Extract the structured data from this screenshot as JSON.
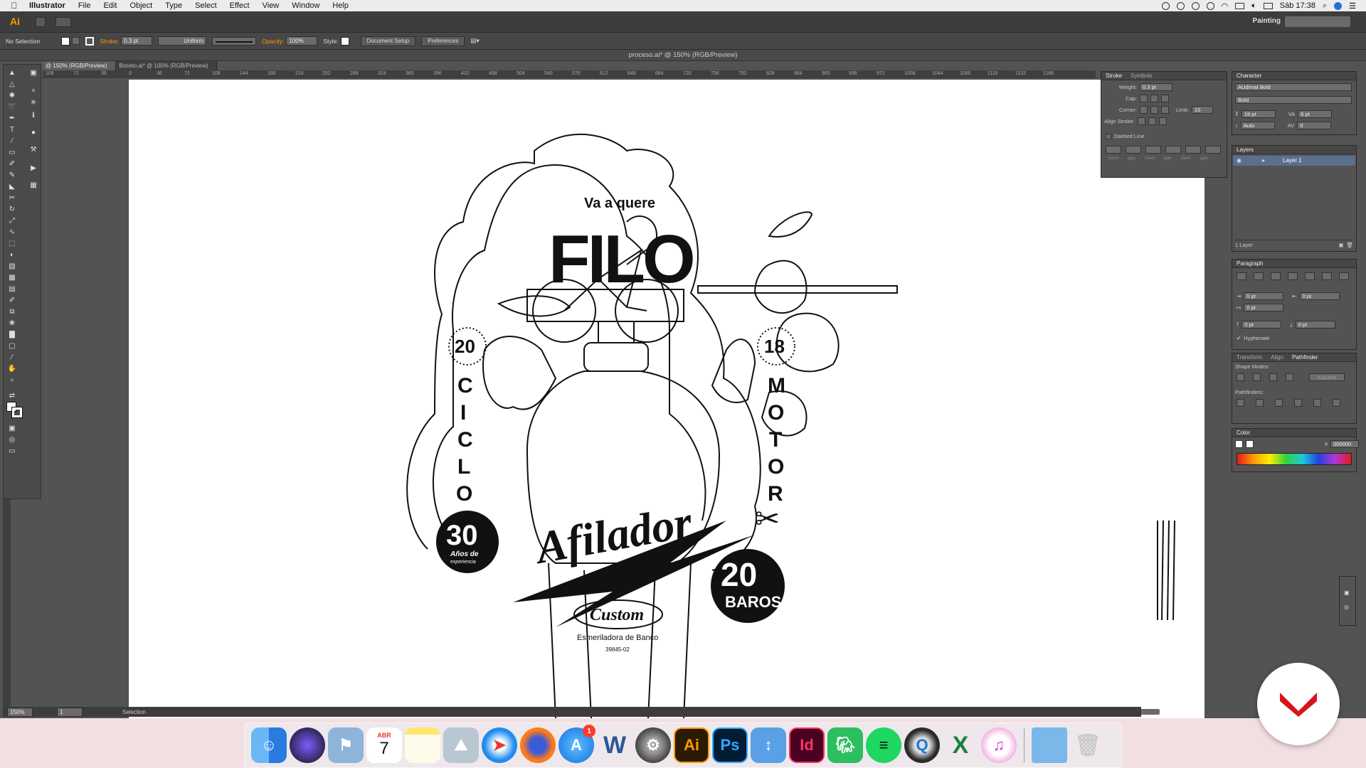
{
  "menubar": {
    "app": "Illustrator",
    "items": [
      "File",
      "Edit",
      "Object",
      "Type",
      "Select",
      "Effect",
      "View",
      "Window",
      "Help"
    ],
    "clock": "Sáb 17:38"
  },
  "appbar": {
    "workspace": "Painting"
  },
  "controlbar": {
    "selection": "No Selection",
    "stroke_label": "Stroke:",
    "stroke_value": "0.3 pt",
    "profile": "Uniform",
    "opacity_label": "Opacity:",
    "opacity_value": "100%",
    "style_label": "Style:",
    "doc_setup": "Document Setup",
    "preferences": "Preferences"
  },
  "title": "proceso.ai* @ 150% (RGB/Preview)",
  "tabs": [
    "@ 150% (RGB/Preview)",
    "Boceto.ai* @ 100% (RGB/Preview)"
  ],
  "ruler_ticks": [
    "108",
    "72",
    "36",
    "0",
    "36",
    "72",
    "108",
    "144",
    "180",
    "216",
    "252",
    "288",
    "324",
    "360",
    "396",
    "432",
    "468",
    "504",
    "540",
    "576",
    "612",
    "648",
    "684",
    "720",
    "756",
    "792",
    "828",
    "864",
    "900",
    "936",
    "972",
    "1008",
    "1044",
    "1080",
    "1116",
    "1152",
    "1188"
  ],
  "status": {
    "zoom": "150%",
    "page": "1",
    "tool": "Selection"
  },
  "stroke_panel": {
    "tabs": [
      "Stroke",
      "Symbols"
    ],
    "weight_label": "Weight:",
    "weight": "0.3 pt",
    "cap_label": "Cap:",
    "corner_label": "Corner:",
    "limit_label": "Limit:",
    "limit": "10",
    "align_label": "Align Stroke:",
    "dashed_label": "Dashed Line",
    "dash_labels": [
      "dash",
      "gap",
      "dash",
      "gap",
      "dash",
      "gap"
    ]
  },
  "character_panel": {
    "title": "Character",
    "font": "AUdimat Bold",
    "style": "Bold",
    "size": "18 pt",
    "tracking": "6 pt",
    "leading": "Auto",
    "kerning": "0"
  },
  "layers_panel": {
    "title": "Layers",
    "layer": "Layer 1",
    "count": "1 Layer"
  },
  "paragraph_panel": {
    "title": "Paragraph",
    "fields": [
      "0 pt",
      "0 pt",
      "0 pt",
      "0 pt",
      "0 pt"
    ],
    "hyphenate": "Hyphenate"
  },
  "pathfinder_panel": {
    "tabs": [
      "Transform",
      "Align",
      "Pathfinder"
    ],
    "shape_modes": "Shape Modes:",
    "expand": "Expand",
    "pathfinders": "Pathfinders:"
  },
  "color_panel": {
    "title": "Color",
    "hex": "000000"
  },
  "artwork": {
    "tagline": "Va a quere",
    "big_word": "FILO",
    "left_number": "20",
    "right_number": "18",
    "left_vertical": [
      "C",
      "I",
      "C",
      "L",
      "O"
    ],
    "right_vertical": [
      "M",
      "O",
      "T",
      "O",
      "R"
    ],
    "badge_left_number": "30",
    "badge_left_text1": "Años de",
    "badge_left_text2": "experiencia",
    "badge_right_number": "20",
    "badge_right_text": "BAROS",
    "brand": "Afilador",
    "sub_brand": "Custom",
    "product": "Esmeriladora de Banco",
    "code": "39845-02"
  },
  "dock": {
    "apps": [
      "finder-icon",
      "siri-icon",
      "preview-icon",
      "calendar-icon",
      "notes-icon",
      "photos-icon",
      "safari-icon",
      "firefox-icon",
      "appstore-icon",
      "word-icon",
      "system-preferences-icon",
      "illustrator-icon",
      "photoshop-icon",
      "keynote-icon",
      "indesign-icon",
      "evernote-icon",
      "spotify-icon",
      "quicktime-icon",
      "excel-icon",
      "itunes-icon"
    ],
    "labels": {
      "calendar_month": "ABR",
      "calendar_day": "7",
      "ai": "Ai",
      "ps": "Ps",
      "id": "Id",
      "w": "W",
      "x": "X",
      "appstore_badge": "1"
    }
  }
}
